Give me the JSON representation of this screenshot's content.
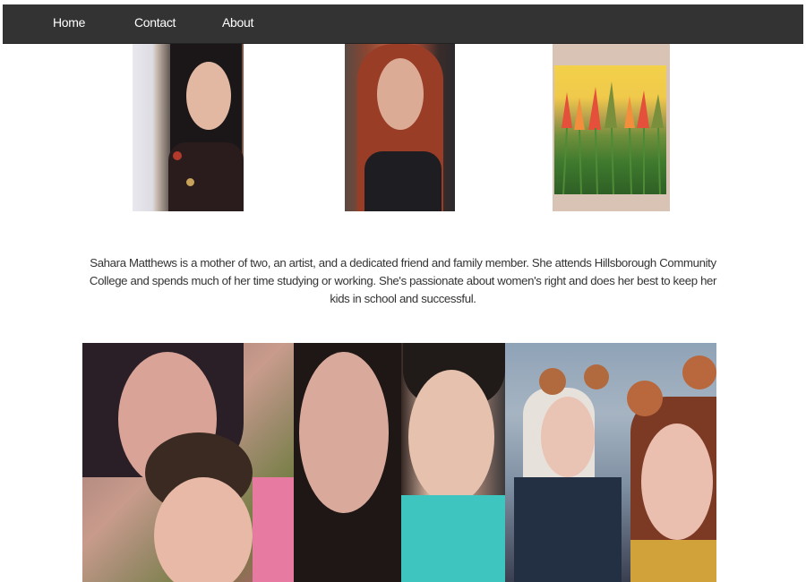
{
  "nav": {
    "items": [
      {
        "label": "Home"
      },
      {
        "label": "Contact"
      },
      {
        "label": "About"
      }
    ]
  },
  "bio": {
    "text": "Sahara Matthews is a mother of two, an artist, and a dedicated friend and family member. She attends Hillsborough Community College and spends much of her time studying or working. She's passionate about women's right and does her best to keep her kids in school and successful."
  },
  "top_photos": [
    {
      "subject": "woman selfie with dark hair and floral top"
    },
    {
      "subject": "woman selfie with red-brown hair"
    },
    {
      "subject": "painting of colorful flowers and grass"
    }
  ],
  "bottom_photos": [
    {
      "subject": "mother and child selfie"
    },
    {
      "subject": "mother and son selfie"
    },
    {
      "subject": "two people with bear ear filter"
    }
  ]
}
